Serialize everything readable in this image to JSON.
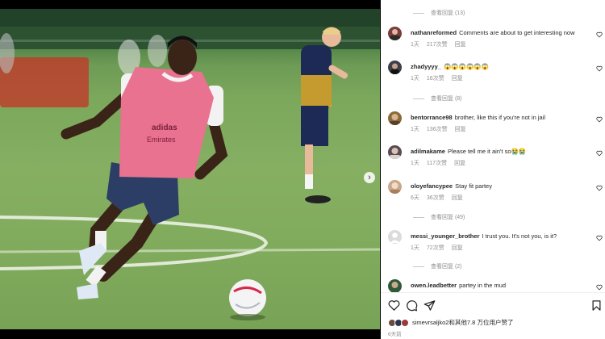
{
  "comments": [
    {
      "user": "nathanreformed",
      "text": "Comments are about to get interesting now",
      "time": "1天",
      "likes": "217次赞",
      "reply": "回复",
      "avatar_color": "#7a3b3b"
    },
    {
      "user": "zhadyyyy_",
      "text": "😱😱😱😱😱😱",
      "time": "1天",
      "likes": "16次赞",
      "reply": "回复",
      "avatar_color": "#3a3f4a"
    },
    {
      "user": "bentorrance98",
      "text": "brother, like this if you're not in jail",
      "time": "1天",
      "likes": "136次赞",
      "reply": "回复",
      "avatar_color": "#8a6a3a"
    },
    {
      "user": "adilmakame",
      "text": "Please tell me it ain't so😭😭",
      "time": "1天",
      "likes": "117次赞",
      "reply": "回复",
      "avatar_color": "#5a4a52"
    },
    {
      "user": "oloyefancypee",
      "text": "Stay fit partey",
      "time": "6天",
      "likes": "36次赞",
      "reply": "回复",
      "avatar_color": "#c9a88a"
    },
    {
      "user": "messi_younger_brother",
      "text": "I trust you. It's not you, is it?",
      "time": "1天",
      "likes": "72次赞",
      "reply": "回复",
      "avatar_color": "#dbdbdb"
    },
    {
      "user": "owen.leadbetter",
      "text": "partey in the mud",
      "avatar_color": "#2f5a3a"
    }
  ],
  "view_replies": [
    "查看回复 (13)",
    "查看回复 (8)",
    "查看回复 (49)",
    "查看回复 (2)"
  ],
  "actions": {
    "like_icon": "heart-outline-icon",
    "comment_icon": "speech-bubble-icon",
    "share_icon": "paper-plane-icon",
    "save_icon": "bookmark-icon"
  },
  "liked_by": "simevrsaljko2和其他7.8 万位用户赞了",
  "posted_time": "6天前",
  "colors": {
    "text": "#262626",
    "meta": "#8e8e8e",
    "bib": "#e8728f",
    "shorts": "#2c3e66"
  }
}
